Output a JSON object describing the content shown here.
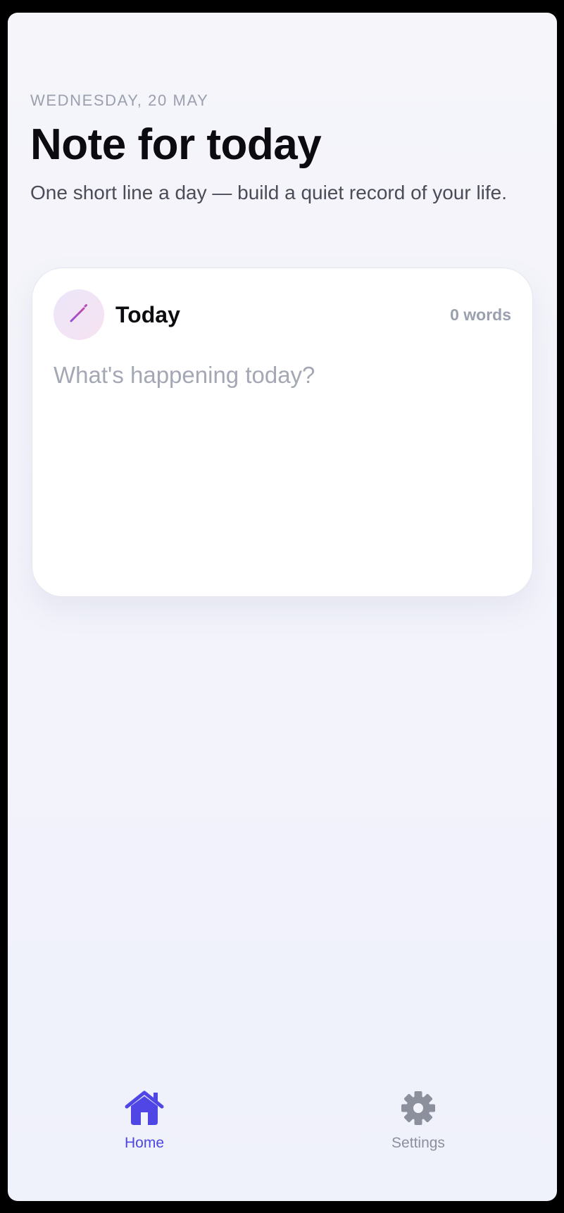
{
  "header": {
    "date": "WEDNESDAY, 20 MAY",
    "title": "Note for today",
    "subtitle": "One short line a day — build a quiet record of your life."
  },
  "card": {
    "icon": "pen-icon",
    "title": "Today",
    "word_count": "0 words",
    "input": {
      "value": "",
      "placeholder": "What's happening today?"
    }
  },
  "tabbar": {
    "items": [
      {
        "label": "Home",
        "icon": "home-icon",
        "active": true
      },
      {
        "label": "Settings",
        "icon": "gear-icon",
        "active": false
      }
    ]
  },
  "colors": {
    "accent": "#4f46e5",
    "inactive": "#8c909c",
    "pen": "#a855c8"
  }
}
